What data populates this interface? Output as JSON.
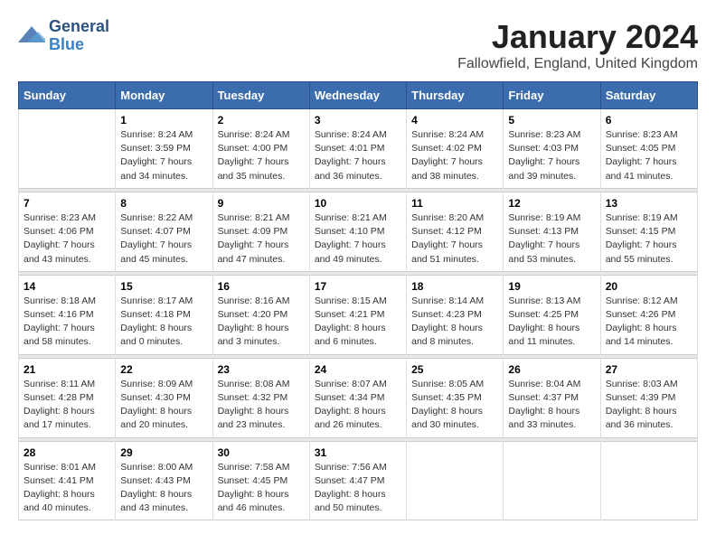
{
  "logo": {
    "line1": "General",
    "line2": "Blue"
  },
  "title": "January 2024",
  "subtitle": "Fallowfield, England, United Kingdom",
  "days_header": [
    "Sunday",
    "Monday",
    "Tuesday",
    "Wednesday",
    "Thursday",
    "Friday",
    "Saturday"
  ],
  "weeks": [
    {
      "days": [
        {
          "num": "",
          "info": ""
        },
        {
          "num": "1",
          "info": "Sunrise: 8:24 AM\nSunset: 3:59 PM\nDaylight: 7 hours\nand 34 minutes."
        },
        {
          "num": "2",
          "info": "Sunrise: 8:24 AM\nSunset: 4:00 PM\nDaylight: 7 hours\nand 35 minutes."
        },
        {
          "num": "3",
          "info": "Sunrise: 8:24 AM\nSunset: 4:01 PM\nDaylight: 7 hours\nand 36 minutes."
        },
        {
          "num": "4",
          "info": "Sunrise: 8:24 AM\nSunset: 4:02 PM\nDaylight: 7 hours\nand 38 minutes."
        },
        {
          "num": "5",
          "info": "Sunrise: 8:23 AM\nSunset: 4:03 PM\nDaylight: 7 hours\nand 39 minutes."
        },
        {
          "num": "6",
          "info": "Sunrise: 8:23 AM\nSunset: 4:05 PM\nDaylight: 7 hours\nand 41 minutes."
        }
      ]
    },
    {
      "days": [
        {
          "num": "7",
          "info": "Sunrise: 8:23 AM\nSunset: 4:06 PM\nDaylight: 7 hours\nand 43 minutes."
        },
        {
          "num": "8",
          "info": "Sunrise: 8:22 AM\nSunset: 4:07 PM\nDaylight: 7 hours\nand 45 minutes."
        },
        {
          "num": "9",
          "info": "Sunrise: 8:21 AM\nSunset: 4:09 PM\nDaylight: 7 hours\nand 47 minutes."
        },
        {
          "num": "10",
          "info": "Sunrise: 8:21 AM\nSunset: 4:10 PM\nDaylight: 7 hours\nand 49 minutes."
        },
        {
          "num": "11",
          "info": "Sunrise: 8:20 AM\nSunset: 4:12 PM\nDaylight: 7 hours\nand 51 minutes."
        },
        {
          "num": "12",
          "info": "Sunrise: 8:19 AM\nSunset: 4:13 PM\nDaylight: 7 hours\nand 53 minutes."
        },
        {
          "num": "13",
          "info": "Sunrise: 8:19 AM\nSunset: 4:15 PM\nDaylight: 7 hours\nand 55 minutes."
        }
      ]
    },
    {
      "days": [
        {
          "num": "14",
          "info": "Sunrise: 8:18 AM\nSunset: 4:16 PM\nDaylight: 7 hours\nand 58 minutes."
        },
        {
          "num": "15",
          "info": "Sunrise: 8:17 AM\nSunset: 4:18 PM\nDaylight: 8 hours\nand 0 minutes."
        },
        {
          "num": "16",
          "info": "Sunrise: 8:16 AM\nSunset: 4:20 PM\nDaylight: 8 hours\nand 3 minutes."
        },
        {
          "num": "17",
          "info": "Sunrise: 8:15 AM\nSunset: 4:21 PM\nDaylight: 8 hours\nand 6 minutes."
        },
        {
          "num": "18",
          "info": "Sunrise: 8:14 AM\nSunset: 4:23 PM\nDaylight: 8 hours\nand 8 minutes."
        },
        {
          "num": "19",
          "info": "Sunrise: 8:13 AM\nSunset: 4:25 PM\nDaylight: 8 hours\nand 11 minutes."
        },
        {
          "num": "20",
          "info": "Sunrise: 8:12 AM\nSunset: 4:26 PM\nDaylight: 8 hours\nand 14 minutes."
        }
      ]
    },
    {
      "days": [
        {
          "num": "21",
          "info": "Sunrise: 8:11 AM\nSunset: 4:28 PM\nDaylight: 8 hours\nand 17 minutes."
        },
        {
          "num": "22",
          "info": "Sunrise: 8:09 AM\nSunset: 4:30 PM\nDaylight: 8 hours\nand 20 minutes."
        },
        {
          "num": "23",
          "info": "Sunrise: 8:08 AM\nSunset: 4:32 PM\nDaylight: 8 hours\nand 23 minutes."
        },
        {
          "num": "24",
          "info": "Sunrise: 8:07 AM\nSunset: 4:34 PM\nDaylight: 8 hours\nand 26 minutes."
        },
        {
          "num": "25",
          "info": "Sunrise: 8:05 AM\nSunset: 4:35 PM\nDaylight: 8 hours\nand 30 minutes."
        },
        {
          "num": "26",
          "info": "Sunrise: 8:04 AM\nSunset: 4:37 PM\nDaylight: 8 hours\nand 33 minutes."
        },
        {
          "num": "27",
          "info": "Sunrise: 8:03 AM\nSunset: 4:39 PM\nDaylight: 8 hours\nand 36 minutes."
        }
      ]
    },
    {
      "days": [
        {
          "num": "28",
          "info": "Sunrise: 8:01 AM\nSunset: 4:41 PM\nDaylight: 8 hours\nand 40 minutes."
        },
        {
          "num": "29",
          "info": "Sunrise: 8:00 AM\nSunset: 4:43 PM\nDaylight: 8 hours\nand 43 minutes."
        },
        {
          "num": "30",
          "info": "Sunrise: 7:58 AM\nSunset: 4:45 PM\nDaylight: 8 hours\nand 46 minutes."
        },
        {
          "num": "31",
          "info": "Sunrise: 7:56 AM\nSunset: 4:47 PM\nDaylight: 8 hours\nand 50 minutes."
        },
        {
          "num": "",
          "info": ""
        },
        {
          "num": "",
          "info": ""
        },
        {
          "num": "",
          "info": ""
        }
      ]
    }
  ]
}
